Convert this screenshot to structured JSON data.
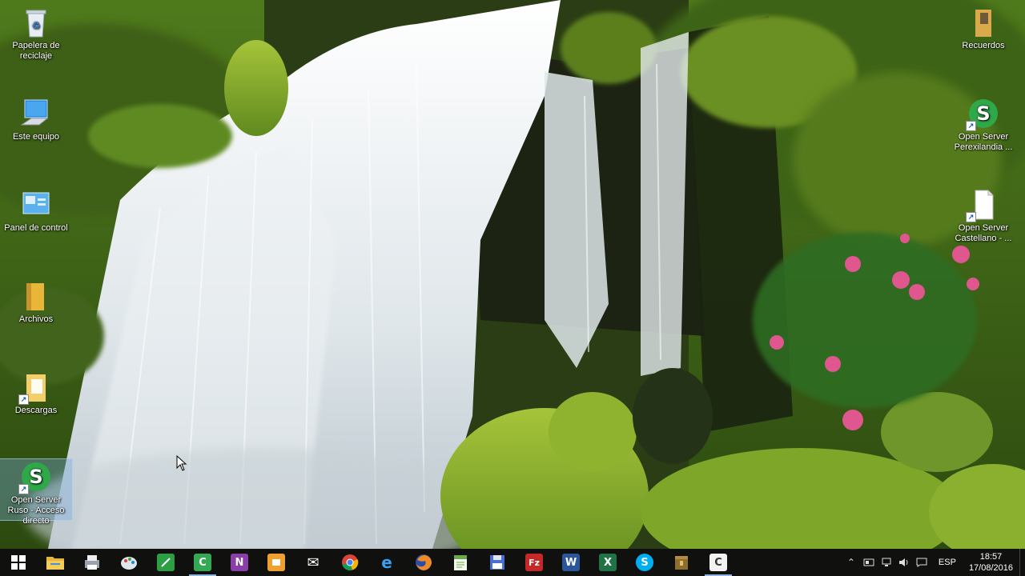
{
  "desktop": {
    "icons_left": [
      {
        "id": "recycle",
        "label": "Papelera de reciclaje",
        "icon": "recycle-bin-icon"
      },
      {
        "id": "thispc",
        "label": "Este equipo",
        "icon": "computer-icon"
      },
      {
        "id": "control",
        "label": "Panel de control",
        "icon": "control-panel-icon"
      },
      {
        "id": "archivos",
        "label": "Archivos",
        "icon": "folder-icon"
      },
      {
        "id": "descargas",
        "label": "Descargas",
        "icon": "folder-shortcut-icon"
      },
      {
        "id": "ruso",
        "label": "Open Server Ruso - Acceso directo",
        "icon": "open-server-icon"
      }
    ],
    "icons_right": [
      {
        "id": "recuerdos",
        "label": "Recuerdos",
        "icon": "photo-folder-icon"
      },
      {
        "id": "perexilandia",
        "label": "Open Server Perexilandia ...",
        "icon": "open-server-icon"
      },
      {
        "id": "castellano",
        "label": "Open Server Castellano - ...",
        "icon": "file-shortcut-icon"
      }
    ]
  },
  "taskbar": {
    "apps": [
      {
        "name": "start-button",
        "glyph": "",
        "color": "transparent"
      },
      {
        "name": "file-explorer-icon",
        "glyph": "",
        "color": "#e8b73a"
      },
      {
        "name": "printer-app-icon",
        "glyph": "",
        "color": "#7d8a9a"
      },
      {
        "name": "paint-app-icon",
        "glyph": "",
        "color": "#4f9fd8"
      },
      {
        "name": "green-app-icon",
        "glyph": "",
        "color": "#2e9e44"
      },
      {
        "name": "c-app-icon",
        "glyph": "C",
        "color": "#35a853"
      },
      {
        "name": "onenote-icon",
        "glyph": "N",
        "color": "#8a3ea8"
      },
      {
        "name": "outlook-app-icon",
        "glyph": "",
        "color": "#f0a030"
      },
      {
        "name": "mail-icon",
        "glyph": "✉",
        "color": "transparent"
      },
      {
        "name": "chrome-icon",
        "glyph": "",
        "color": "transparent"
      },
      {
        "name": "edge-icon",
        "glyph": "e",
        "color": "transparent"
      },
      {
        "name": "firefox-icon",
        "glyph": "",
        "color": "transparent"
      },
      {
        "name": "notepad-green-icon",
        "glyph": "",
        "color": "#6aa84f"
      },
      {
        "name": "save-app-icon",
        "glyph": "",
        "color": "#4a6fd0"
      },
      {
        "name": "filezilla-icon",
        "glyph": "Fz",
        "color": "#c62828"
      },
      {
        "name": "word-icon",
        "glyph": "W",
        "color": "#2b579a"
      },
      {
        "name": "excel-icon",
        "glyph": "X",
        "color": "#217346"
      },
      {
        "name": "skype-icon",
        "glyph": "S",
        "color": "#00aff0"
      },
      {
        "name": "archive-app-icon",
        "glyph": "",
        "color": "#8d6e2f"
      },
      {
        "name": "c-app-white-icon",
        "glyph": "C",
        "color": "#f2f2f2"
      }
    ],
    "tray": {
      "language": "ESP",
      "time": "18:57",
      "date": "17/08/2016",
      "icons": [
        "chevron-up-icon",
        "tray-app-icon",
        "network-icon",
        "volume-icon",
        "action-center-icon"
      ]
    }
  }
}
